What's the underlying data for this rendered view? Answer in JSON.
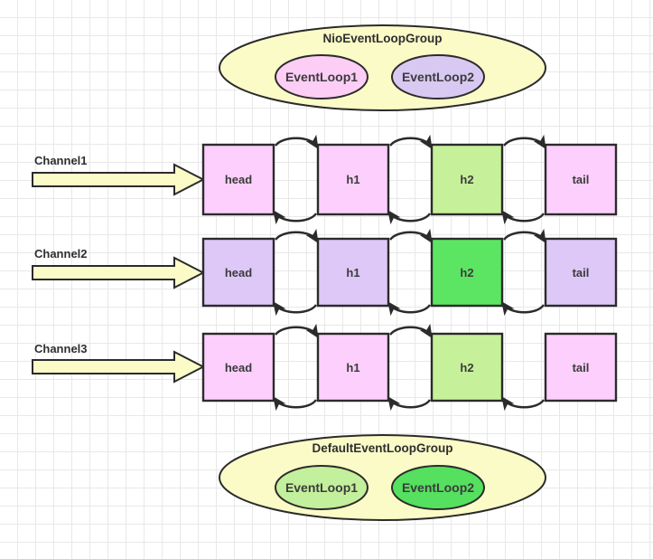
{
  "diagram": {
    "title": "Netty pipeline and EventLoopGroup diagram",
    "background": {
      "grid_color": "#e8e8e8",
      "grid_size": 20,
      "page_color": "#ffffff"
    },
    "palette": {
      "pink": "#fccffc",
      "light_purple": "#ddc8f7",
      "light_green": "#c6f09a",
      "bright_green": "#55e martin",
      "bright_green_hex": "#5ce563",
      "pale_yellow": "#fbfbc8",
      "loop_pink": "#fccdf5",
      "loop_purple": "#d8c9f2",
      "loop_light_green": "#c3f09c",
      "loop_bright_green": "#55e05f",
      "stroke": "#2b2b2b",
      "text": "#3b3b3b"
    },
    "top_group": {
      "name": "top-event-loop-group",
      "title": "NioEventLoopGroup",
      "fill": "#fbfbc8",
      "loops": [
        {
          "label": "EventLoop1",
          "fill": "#fccdf5"
        },
        {
          "label": "EventLoop2",
          "fill": "#d8c9f2"
        }
      ]
    },
    "bottom_group": {
      "name": "bottom-event-loop-group",
      "title": "DefaultEventLoopGroup",
      "fill": "#fbfbc8",
      "loops": [
        {
          "label": "EventLoop1",
          "fill": "#c3f09c"
        },
        {
          "label": "EventLoop2",
          "fill": "#55e05f"
        }
      ]
    },
    "channels": [
      {
        "name": "channel-1",
        "label": "Channel1",
        "arrow_fill": "#fbfbc8",
        "handlers": [
          {
            "label": "head",
            "fill": "#fccffc"
          },
          {
            "label": "h1",
            "fill": "#fccffc"
          },
          {
            "label": "h2",
            "fill": "#c6f09a"
          },
          {
            "label": "tail",
            "fill": "#fccffc"
          }
        ],
        "connectors": [
          {
            "between": "head-h1",
            "top_arrow": true,
            "bottom_arrow": true
          },
          {
            "between": "h1-h2",
            "top_arrow": true,
            "bottom_arrow": true
          },
          {
            "between": "h2-tail",
            "top_arrow": true,
            "bottom_arrow": true
          }
        ]
      },
      {
        "name": "channel-2",
        "label": "Channel2",
        "arrow_fill": "#fbfbc8",
        "handlers": [
          {
            "label": "head",
            "fill": "#ddc8f7"
          },
          {
            "label": "h1",
            "fill": "#ddc8f7"
          },
          {
            "label": "h2",
            "fill": "#5ce563"
          },
          {
            "label": "tail",
            "fill": "#ddc8f7"
          }
        ],
        "connectors": [
          {
            "between": "head-h1",
            "top_arrow": true,
            "bottom_arrow": true
          },
          {
            "between": "h1-h2",
            "top_arrow": true,
            "bottom_arrow": true
          },
          {
            "between": "h2-tail",
            "top_arrow": true,
            "bottom_arrow": true
          }
        ]
      },
      {
        "name": "channel-3",
        "label": "Channel3",
        "arrow_fill": "#fbfbc8",
        "handlers": [
          {
            "label": "head",
            "fill": "#fccffc"
          },
          {
            "label": "h1",
            "fill": "#fccffc"
          },
          {
            "label": "h2",
            "fill": "#c6f09a"
          },
          {
            "label": "tail",
            "fill": "#fccffc"
          }
        ],
        "connectors": [
          {
            "between": "head-h1",
            "top_arrow": true,
            "bottom_arrow": true
          },
          {
            "between": "h1-h2",
            "top_arrow": true,
            "bottom_arrow": true
          },
          {
            "between": "h2-tail",
            "top_arrow": false,
            "bottom_arrow": true
          }
        ]
      }
    ]
  }
}
